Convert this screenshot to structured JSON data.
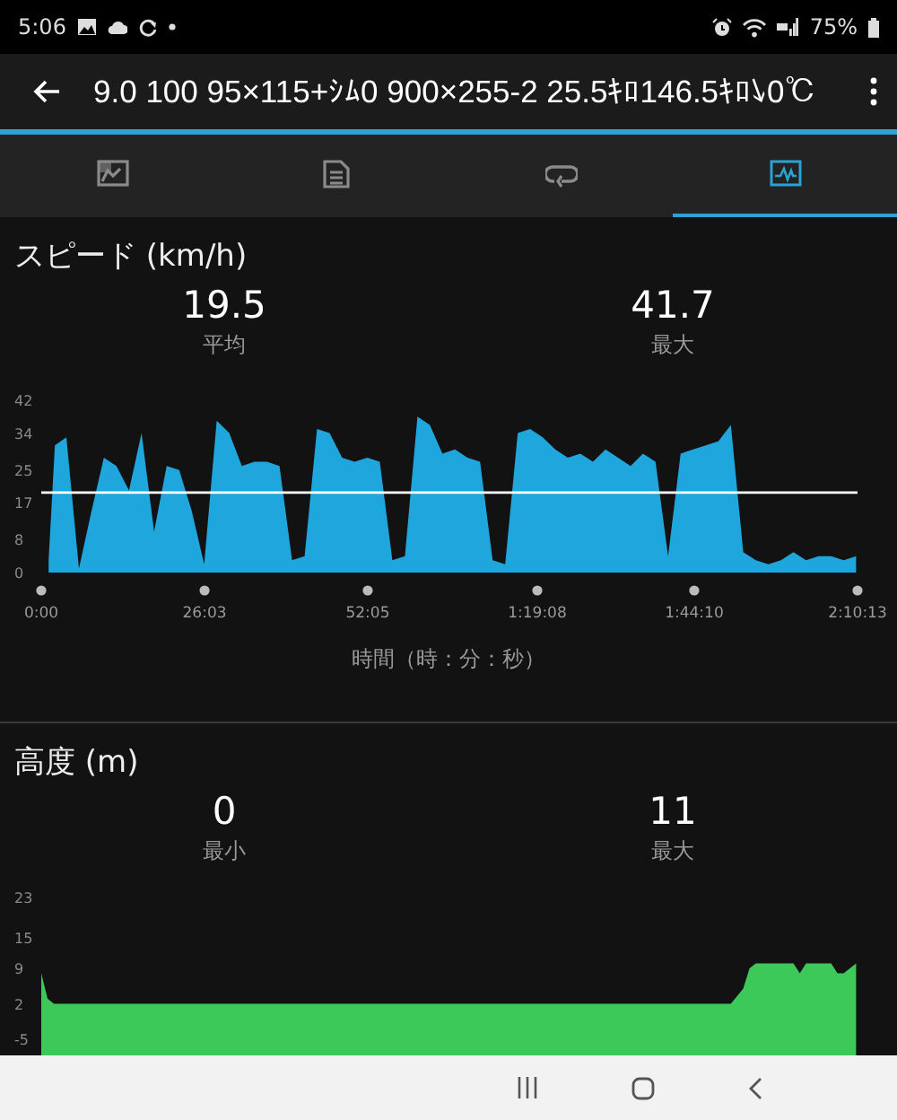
{
  "status_bar": {
    "time": "5:06",
    "battery": "75%"
  },
  "app_bar": {
    "title": "9.0 100 95×115+ｼﾑ0 900×255-2 25.5ｷﾛ146.5ｷﾛ↘0℃"
  },
  "tabs": [
    {
      "kind": "map",
      "selected": false
    },
    {
      "kind": "details",
      "selected": false
    },
    {
      "kind": "laps",
      "selected": false
    },
    {
      "kind": "charts",
      "selected": true
    }
  ],
  "sections": [
    {
      "title": "スピード (km/h)",
      "stats": [
        {
          "value": "19.5",
          "label": "平均"
        },
        {
          "value": "41.7",
          "label": "最大"
        }
      ],
      "chart_data": {
        "type": "area",
        "xlabel": "時間（時：分：秒）",
        "x": [
          70,
          130,
          240,
          360,
          480,
          600,
          720,
          840,
          960,
          1080,
          1200,
          1320,
          1440,
          1560,
          1680,
          1800,
          1920,
          2040,
          2160,
          2280,
          2400,
          2520,
          2640,
          2760,
          2880,
          3000,
          3120,
          3240,
          3360,
          3480,
          3600,
          3720,
          3840,
          3960,
          4080,
          4200,
          4320,
          4440,
          4560,
          4680,
          4800,
          4920,
          5040,
          5160,
          5280,
          5400,
          5520,
          5640,
          5760,
          5880,
          6000,
          6120,
          6240,
          6360,
          6480,
          6600,
          6720,
          6840,
          6960,
          7080,
          7200,
          7320,
          7440,
          7560,
          7680,
          7800
        ],
        "series": [
          {
            "color": "#1fa6dc",
            "values": [
              3,
              31,
              33,
              1,
              15,
              28,
              26,
              20,
              34,
              10,
              26,
              25,
              15,
              2,
              37,
              34,
              26,
              27,
              27,
              26,
              3,
              4,
              35,
              34,
              28,
              27,
              28,
              27,
              3,
              4,
              38,
              36,
              29,
              30,
              28,
              27,
              3,
              2,
              34,
              35,
              33,
              30,
              28,
              29,
              27,
              30,
              28,
              26,
              29,
              27,
              4,
              29,
              30,
              31,
              32,
              36,
              5,
              3,
              2,
              3,
              5,
              3,
              4,
              4,
              3,
              4
            ]
          }
        ],
        "xlim": [
          0,
          7813
        ],
        "ylim": [
          0,
          42
        ],
        "xticks": [
          {
            "value": 0,
            "label": "0:00"
          },
          {
            "value": 1563,
            "label": "26:03"
          },
          {
            "value": 3125,
            "label": "52:05"
          },
          {
            "value": 4748,
            "label": "1:19:08"
          },
          {
            "value": 6250,
            "label": "1:44:10"
          },
          {
            "value": 7813,
            "label": "2:10:13"
          }
        ],
        "yticks": [
          0,
          8,
          17,
          25,
          34,
          42
        ],
        "ref_lines": [
          {
            "axis": "y",
            "value": 19.5
          }
        ]
      }
    },
    {
      "title": "高度 (m)",
      "stats": [
        {
          "value": "0",
          "label": "最小"
        },
        {
          "value": "11",
          "label": "最大"
        }
      ],
      "chart_data": {
        "type": "area",
        "x": [
          0,
          60,
          120,
          1200,
          2400,
          3600,
          4800,
          6000,
          6600,
          6720,
          6780,
          6840,
          6960,
          7080,
          7200,
          7260,
          7320,
          7440,
          7560,
          7620,
          7680,
          7800
        ],
        "series": [
          {
            "color": "#3cc95a",
            "values": [
              8,
              3,
              2,
              2,
              2,
              2,
              2,
              2,
              2,
              5,
              9,
              10,
              10,
              10,
              10,
              8,
              10,
              10,
              10,
              8,
              8,
              10
            ]
          }
        ],
        "xlim": [
          0,
          7813
        ],
        "ylim": [
          -5,
          23
        ],
        "yticks": [
          -5,
          2,
          9,
          15,
          23
        ]
      }
    }
  ]
}
